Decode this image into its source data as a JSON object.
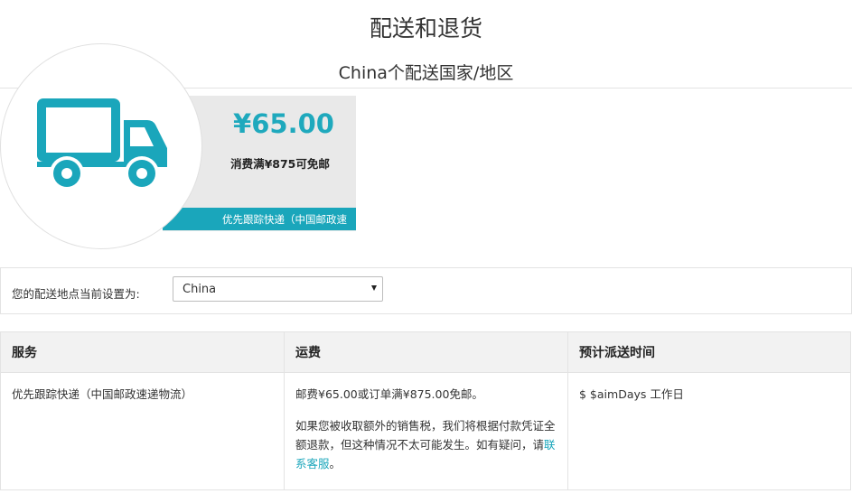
{
  "header": {
    "title": "配送和退货",
    "subtitle": "China个配送国家/地区"
  },
  "hero": {
    "price": "¥65.00",
    "free_shipping": "消费满¥875可免邮",
    "service_banner": "优先跟踪快递（中国邮政速",
    "icon": "truck-icon",
    "accent_color": "#1aa6bb"
  },
  "location": {
    "label": "您的配送地点当前设置为:",
    "selected_country": "China"
  },
  "table": {
    "headers": [
      "服务",
      "运费",
      "预计派送时间"
    ],
    "rows": [
      {
        "service": "优先跟踪快递（中国邮政速递物流）",
        "cost": "邮费¥65.00或订单满¥875.00免邮。",
        "note": "如果您被收取额外的销售税，我们将根据付款凭证全额退款，但这种情况不太可能发生。如有疑问，请",
        "contact_link": "联系客服",
        "note_end": "。",
        "delivery": "$ $aimDays 工作日"
      }
    ]
  }
}
